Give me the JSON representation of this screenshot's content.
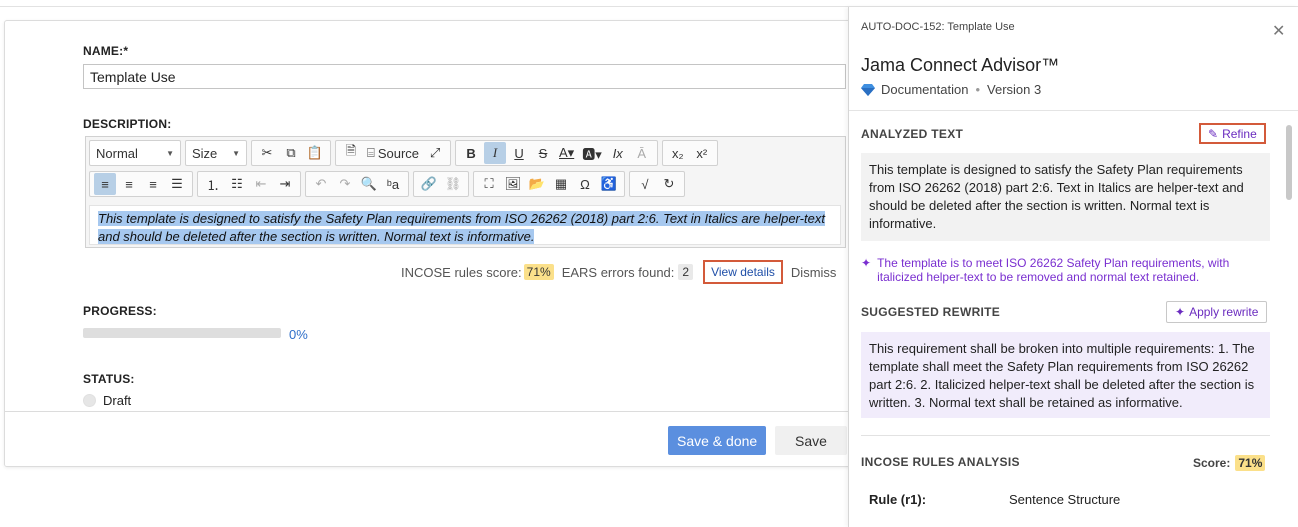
{
  "form": {
    "name_label": "NAME:*",
    "name_value": "Template Use",
    "description_label": "DESCRIPTION:",
    "toolbar": {
      "format_select": "Normal",
      "size_select": "Size",
      "source_label": "Source"
    },
    "description_text": "This template is designed to satisfy the Safety Plan requirements from ISO 26262 (2018) part 2:6. Text in Italics are helper-text and should be deleted after the section is written. Normal text is informative.",
    "incose_label": "INCOSE rules score:",
    "incose_score": "71%",
    "ears_label": "EARS errors found:",
    "ears_count": "2",
    "view_details": "View details",
    "dismiss": "Dismiss",
    "progress_label": "PROGRESS:",
    "progress_value": "0%",
    "progress_fraction": 0,
    "status_label": "STATUS:",
    "status_value": "Draft",
    "save_done": "Save & done",
    "save": "Save"
  },
  "advisor": {
    "doc_id": "AUTO-DOC-152: Template Use",
    "title": "Jama Connect Advisor™",
    "item_type": "Documentation",
    "version": "Version 3",
    "analyzed_title": "ANALYZED TEXT",
    "refine": "Refine",
    "analyzed_text": "This template is designed to satisfy the Safety Plan requirements from ISO 26262 (2018) part 2:6. Text in Italics are helper-text and should be deleted after the section is written. Normal text is informative.",
    "summary": "The template is to meet ISO 26262 Safety Plan requirements, with italicized helper-text to be removed and normal text retained.",
    "rewrite_title": "SUGGESTED REWRITE",
    "apply_rewrite": "Apply rewrite",
    "rewrite_text": "This requirement shall be broken into multiple requirements: 1. The template shall meet the Safety Plan requirements from ISO 26262 part 2:6. 2. Italicized helper-text shall be deleted after the section is written. 3. Normal text shall be retained as informative.",
    "incose_title": "INCOSE RULES ANALYSIS",
    "score_label": "Score:",
    "score_value": "71%",
    "rule_key": "Rule (r1):",
    "rule_value": "Sentence Structure"
  },
  "colors": {
    "accent_blue": "#5b8fdf",
    "link_blue": "#1f4fa8",
    "ai_purple": "#7a2fd0",
    "highlight_red": "#d35a3a",
    "score_yellow": "#fbe08a"
  }
}
